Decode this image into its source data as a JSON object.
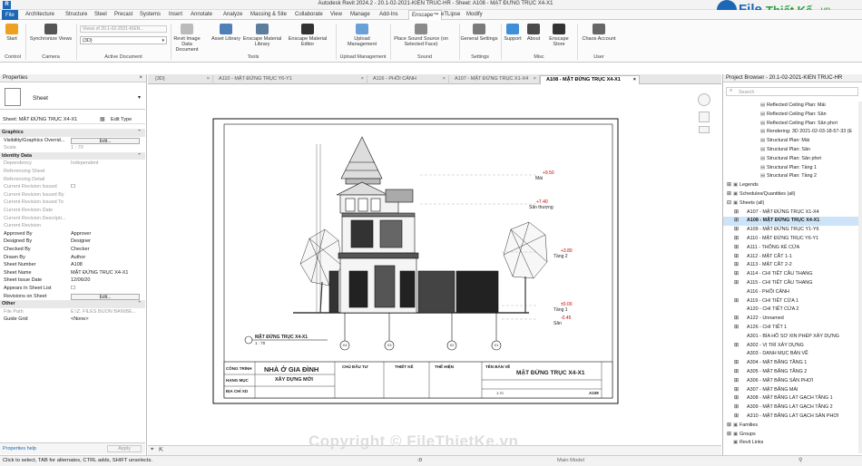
{
  "window": {
    "title": "Autodesk Revit 2024.2 - 20.1-02-2021-KIEN TRUC-HR - Sheet: A108 - MẶT ĐỨNG TRỤC X4-X1"
  },
  "logo": {
    "text_a": "File",
    "text_b": "Thiết Kế",
    "text_c": ".vn"
  },
  "menu": [
    "File",
    "Architecture",
    "Structure",
    "Steel",
    "Precast",
    "Systems",
    "Insert",
    "Annotate",
    "Analyze",
    "Massing & Site",
    "Collaborate",
    "View",
    "Manage",
    "Add-Ins",
    "Enscape™",
    "eTLipse",
    "Modify"
  ],
  "menu_active": "Enscape™",
  "ribbon": {
    "buttons": [
      {
        "label": "Start",
        "color": "#f0a020"
      },
      {
        "label": "Synchronize Views",
        "color": "#555555"
      },
      {
        "label": "Revit Image Data Document",
        "color": "#bbbbbb"
      },
      {
        "label": "Asset Library",
        "color": "#4f7fb8"
      },
      {
        "label": "Enscape Material Library",
        "color": "#5c7d9c"
      },
      {
        "label": "Enscape Material Editor",
        "color": "#333333"
      },
      {
        "label": "Upload Management",
        "color": "#6aa0d8"
      },
      {
        "label": "Place Sound Source (on Selected Face)",
        "color": "#8a8a8a"
      },
      {
        "label": "General Settings",
        "color": "#7a7a7a"
      },
      {
        "label": "Support",
        "color": "#3f8fd8"
      },
      {
        "label": "About",
        "color": "#4a4a4a"
      },
      {
        "label": "Enscape Store",
        "color": "#333333"
      },
      {
        "label": "Chaos Account",
        "color": "#666666"
      }
    ],
    "view_field": "Views of 20.1-02-2021-KIEN...",
    "view_dropdown": "{3D}",
    "groups": [
      "Control",
      "Camera",
      "Active Document",
      "Tools",
      "Upload Management",
      "Sound",
      "Settings",
      "Misc",
      "User"
    ]
  },
  "properties": {
    "header": "Properties",
    "type_name": "Sheet",
    "selector": "Sheet: MẶT ĐỨNG TRỤC X4-X1",
    "edit_type": "Edit Type",
    "rows": [
      {
        "k": "Graphics",
        "v": "",
        "cat": true
      },
      {
        "k": "Visibility/Graphics Overrid...",
        "v": "Edit...",
        "btn": true
      },
      {
        "k": "Scale",
        "v": "1 : 70",
        "dim": true
      },
      {
        "k": "Identity Data",
        "v": "",
        "cat": true
      },
      {
        "k": "Dependency",
        "v": "Independent",
        "dim": true
      },
      {
        "k": "Referencing Sheet",
        "v": "",
        "dim": true
      },
      {
        "k": "Referencing Detail",
        "v": "",
        "dim": true
      },
      {
        "k": "Current Revision Issued",
        "v": "",
        "dim": true,
        "check": true
      },
      {
        "k": "Current Revision Issued By",
        "v": "",
        "dim": true
      },
      {
        "k": "Current Revision Issued To",
        "v": "",
        "dim": true
      },
      {
        "k": "Current Revision Date",
        "v": "",
        "dim": true
      },
      {
        "k": "Current Revision Descripti...",
        "v": "",
        "dim": true
      },
      {
        "k": "Current Revision",
        "v": "",
        "dim": true
      },
      {
        "k": "Approved By",
        "v": "Approver"
      },
      {
        "k": "Designed By",
        "v": "Designer"
      },
      {
        "k": "Checked By",
        "v": "Checker"
      },
      {
        "k": "Drawn By",
        "v": "Author"
      },
      {
        "k": "Sheet Number",
        "v": "A108"
      },
      {
        "k": "Sheet Name",
        "v": "MẶT ĐỨNG TRỤC X4-X1"
      },
      {
        "k": "Sheet Issue Date",
        "v": "12/06/20"
      },
      {
        "k": "Appears In Sheet List",
        "v": "",
        "check": true
      },
      {
        "k": "Revisions on Sheet",
        "v": "Edit...",
        "btn": true
      },
      {
        "k": "Other",
        "v": "",
        "cat": true
      },
      {
        "k": "File Path",
        "v": "E:\\Z. FILES BUON BAN\\BE...",
        "dim": true
      },
      {
        "k": "Guide Grid",
        "v": "<None>"
      }
    ],
    "help": "Properties help",
    "apply": "Apply"
  },
  "tabs": [
    {
      "label": "{3D}",
      "active": false
    },
    {
      "label": "A110 - MẶT ĐỨNG TRỤC Y6-Y1",
      "active": false
    },
    {
      "label": "A116 - PHỐI CẢNH",
      "active": false
    },
    {
      "label": "A107 - MẶT ĐỨNG TRỤC X1-X4",
      "active": false
    },
    {
      "label": "A108 - MẶT ĐỨNG TRỤC X4-X1",
      "active": true
    }
  ],
  "drawing": {
    "levels": [
      {
        "name": "Mái",
        "value": "+9.50"
      },
      {
        "name": "Sân thượng",
        "value": "+7.40"
      },
      {
        "name": "Tầng 2",
        "value": "+3.80"
      },
      {
        "name": "Tầng 1",
        "value": "±0.00"
      },
      {
        "name": "Sân",
        "value": "-0.45"
      }
    ],
    "grid_labels": [
      "X4",
      "X3",
      "X2",
      "X1"
    ],
    "view_title": "MẶT ĐỨNG TRỤC X4-X1",
    "view_scale": "1 : 70",
    "title_block": {
      "company_label": "CÔNG TRÌNH",
      "project": "NHÀ Ở GIA ĐÌNH",
      "category_label": "HẠNG MỤC",
      "category": "XÂY DỰNG MỚI",
      "address_label": "ĐỊA CHỈ XD",
      "owner": "CHỦ ĐẦU TƯ",
      "designer": "THIẾT KẾ",
      "executor": "THỂ HIỆN",
      "sheet_label": "TÊN BẢN VẼ",
      "sheet_name": "MẶT ĐỨNG TRỤC X4-X1",
      "sheet_code": "A108",
      "scale": "1:70"
    }
  },
  "browser": {
    "header": "Project Browser - 20.1-02-2021-KIEN TRUC-HR",
    "search": "Search",
    "items": [
      {
        "label": "Reflected Ceiling Plan: Mái",
        "indent": 4
      },
      {
        "label": "Reflected Ceiling Plan: Sân",
        "indent": 4
      },
      {
        "label": "Reflected Ceiling Plan: Sân phơi",
        "indent": 4
      },
      {
        "label": "Rendering: 3D 2021-02-03-18-57-33 (E",
        "indent": 4
      },
      {
        "label": "Structural Plan: Mái",
        "indent": 4
      },
      {
        "label": "Structural Plan: Sân",
        "indent": 4
      },
      {
        "label": "Structural Plan: Sân phơi",
        "indent": 4
      },
      {
        "label": "Structural Plan: Tầng 1",
        "indent": 4
      },
      {
        "label": "Structural Plan: Tầng 2",
        "indent": 4
      },
      {
        "label": "Legends",
        "indent": 0,
        "toggle": "+"
      },
      {
        "label": "Schedules/Quantities (all)",
        "indent": 0,
        "toggle": "+"
      },
      {
        "label": "Sheets (all)",
        "indent": 0,
        "toggle": "-"
      },
      {
        "label": "A107 - MẶT ĐỨNG TRỤC X1-X4",
        "indent": 1,
        "toggle": "+"
      },
      {
        "label": "A108 - MẶT ĐỨNG TRỤC X4-X1",
        "indent": 1,
        "toggle": "+",
        "sel": true
      },
      {
        "label": "A109 - MẶT ĐỨNG TRỤC Y1-Y6",
        "indent": 1,
        "toggle": "+"
      },
      {
        "label": "A110 - MẶT ĐỨNG TRỤC Y6-Y1",
        "indent": 1,
        "toggle": "+"
      },
      {
        "label": "A111 - THỐNG KÊ CỬA",
        "indent": 1,
        "toggle": "+"
      },
      {
        "label": "A112 - MẶT CẮT 1-1",
        "indent": 1,
        "toggle": "+"
      },
      {
        "label": "A113 - MẶT CẮT 2-2",
        "indent": 1,
        "toggle": "+"
      },
      {
        "label": "A114 - CHI TIẾT CẦU THANG",
        "indent": 1,
        "toggle": "+"
      },
      {
        "label": "A115 - CHI TIẾT CẦU THANG",
        "indent": 1,
        "toggle": "+"
      },
      {
        "label": "A116 - PHỐI CẢNH",
        "indent": 1
      },
      {
        "label": "A119 - CHI TIẾT CỬA 1",
        "indent": 1,
        "toggle": "+"
      },
      {
        "label": "A120 - CHI TIẾT CỬA 2",
        "indent": 1
      },
      {
        "label": "A122 - Unnamed",
        "indent": 1,
        "toggle": "+"
      },
      {
        "label": "A126 - CHI TIẾT 1",
        "indent": 1,
        "toggle": "+"
      },
      {
        "label": "A301 - BÌA HỒ SƠ XIN PHÉP XÂY DỰNG",
        "indent": 1
      },
      {
        "label": "A302 - VỊ TRÍ XÂY DỰNG",
        "indent": 1,
        "toggle": "+"
      },
      {
        "label": "A303 - DANH MỤC BẢN VẼ",
        "indent": 1
      },
      {
        "label": "A304 - MẶT BẰNG TẦNG 1",
        "indent": 1,
        "toggle": "+"
      },
      {
        "label": "A305 - MẶT BẰNG TẦNG 2",
        "indent": 1,
        "toggle": "+"
      },
      {
        "label": "A306 - MẶT BẰNG SÂN PHƠI",
        "indent": 1,
        "toggle": "+"
      },
      {
        "label": "A307 - MẶT BẰNG MÁI",
        "indent": 1,
        "toggle": "+"
      },
      {
        "label": "A308 - MẶT BẰNG LÁT GẠCH TẦNG 1",
        "indent": 1,
        "toggle": "+"
      },
      {
        "label": "A309 - MẶT BẰNG LÁT GẠCH TẦNG 2",
        "indent": 1,
        "toggle": "+"
      },
      {
        "label": "A310 - MẶT BẰNG LÁT GẠCH SÂN PHƠI",
        "indent": 1,
        "toggle": "+"
      },
      {
        "label": "Families",
        "indent": 0,
        "toggle": "+"
      },
      {
        "label": "Groups",
        "indent": 0,
        "toggle": "+"
      },
      {
        "label": "Revit Links",
        "indent": 0
      }
    ]
  },
  "status": {
    "text": "Click to select, TAB for alternates, CTRL adds, SHIFT unselects.",
    "scale_field": ":0",
    "model": "Main Model"
  },
  "watermark": "Copyright © FileThietKe.vn"
}
